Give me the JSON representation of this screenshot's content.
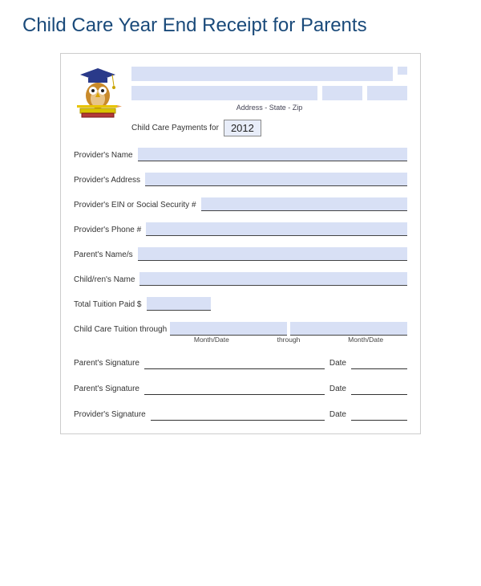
{
  "title": "Child Care Year End Receipt for Parents",
  "header": {
    "address_label": "Address - State - Zip",
    "payments_label": "Child Care Payments for",
    "year": "2012"
  },
  "fields": {
    "provider_name": "Provider's Name",
    "provider_address": "Provider's Address",
    "provider_ein": "Provider's EIN or Social Security #",
    "provider_phone": "Provider's Phone #",
    "parent_names": "Parent's Name/s",
    "children_name": "Child/ren's Name",
    "total_tuition": "Total Tuition Paid $",
    "tuition_through": "Child Care Tuition through",
    "month_date": "Month/Date",
    "through": "through"
  },
  "signatures": {
    "parent": "Parent's Signature",
    "provider": "Provider's Signature",
    "date": "Date"
  }
}
